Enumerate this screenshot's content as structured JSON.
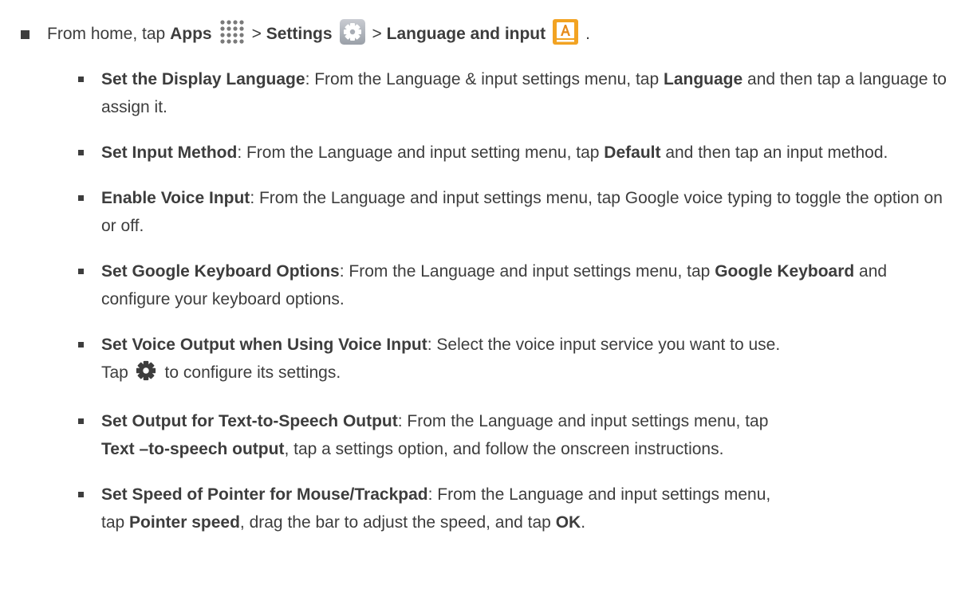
{
  "intro": {
    "prefix": "From home, tap ",
    "apps": "Apps",
    "sep1": " > ",
    "settings": "Settings",
    "sep2": " > ",
    "lang_input": "Language and input",
    "end": ".",
    "icons": [
      "apps-grid-icon",
      "settings-gear-icon",
      "language-input-icon"
    ]
  },
  "items": [
    {
      "title": "Set the Display Language",
      "text1": ": From the Language & input settings menu, tap ",
      "bold1": "Language",
      "text2": " and then tap a language to assign it."
    },
    {
      "title": "Set Input Method",
      "text1": ": From the Language and input setting menu, tap ",
      "bold1": "Default",
      "text2": " and then tap an input method."
    },
    {
      "title": "Enable Voice Input",
      "text1": ": From the Language and input settings menu, tap Google voice typing to toggle the option on or off."
    },
    {
      "title": "Set Google Keyboard Options",
      "text1": ": From the Language and input settings menu, tap ",
      "bold1": "Google Keyboard",
      "text2": " and configure your keyboard options."
    },
    {
      "title": "Set Voice Output when Using Voice Input",
      "text1": ": Select the voice input service you want to use.",
      "text2": "Tap ",
      "text3": " to configure its settings.",
      "icon": "gear-icon"
    },
    {
      "title": "Set Output for Text-to-Speech Output",
      "text1": ": From the Language and input settings menu, tap ",
      "bold1": "Text –to-speech output",
      "text2": ", tap a settings option, and follow the onscreen instructions."
    },
    {
      "title": "Set Speed of Pointer for Mouse/Trackpad",
      "text1": ": From the Language and input settings menu, tap ",
      "bold1": "Pointer speed",
      "text2": ", drag the bar to adjust the speed, and tap ",
      "bold2": "OK",
      "text3": "."
    }
  ]
}
